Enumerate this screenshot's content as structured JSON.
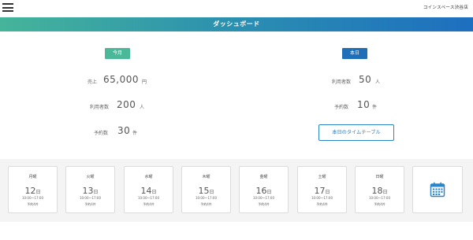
{
  "header": {
    "menu_icon": "hamburger-menu-icon",
    "store_name": "コインスペース渋谷店"
  },
  "title": "ダッシュボード",
  "colors": {
    "gradient_start": "#44b59a",
    "gradient_end": "#1d6fbf",
    "month_badge": "#4cb89a",
    "today_badge": "#1f6fb8",
    "accent_blue": "#2a86c7"
  },
  "month": {
    "badge": "今月",
    "sales_label": "売上",
    "sales_value": "65,000",
    "sales_unit": "円",
    "users_label": "利用者数",
    "users_value": "200",
    "users_unit": "人",
    "bookings_label": "予約数",
    "bookings_value": "30",
    "bookings_unit": "件"
  },
  "today": {
    "badge": "本日",
    "users_label": "利用者数",
    "users_value": "50",
    "users_unit": "人",
    "bookings_label": "予約数",
    "bookings_value": "10",
    "bookings_unit": "件",
    "timetable_button": "本日のタイムテーブル"
  },
  "week": [
    {
      "dow": "月曜",
      "date": "12",
      "suffix": "日",
      "hours": "10:00〜17:00",
      "bookings": "予約4件"
    },
    {
      "dow": "火曜",
      "date": "13",
      "suffix": "日",
      "hours": "10:00〜17:00",
      "bookings": "予約4件"
    },
    {
      "dow": "水曜",
      "date": "14",
      "suffix": "日",
      "hours": "10:00〜17:00",
      "bookings": "予約4件"
    },
    {
      "dow": "木曜",
      "date": "15",
      "suffix": "日",
      "hours": "10:00〜17:00",
      "bookings": "予約4件"
    },
    {
      "dow": "金曜",
      "date": "16",
      "suffix": "日",
      "hours": "10:00〜17:00",
      "bookings": "予約4件"
    },
    {
      "dow": "土曜",
      "date": "17",
      "suffix": "日",
      "hours": "10:00〜17:00",
      "bookings": "予約4件"
    },
    {
      "dow": "日曜",
      "date": "18",
      "suffix": "日",
      "hours": "10:00〜17:00",
      "bookings": "予約4件"
    }
  ],
  "calendar_icon": "calendar-icon"
}
